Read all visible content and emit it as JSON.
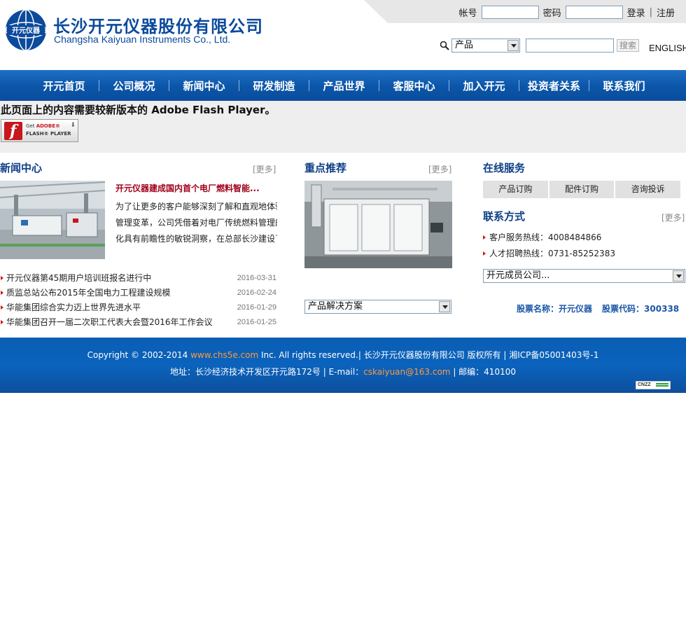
{
  "header": {
    "company_cn": "长沙开元仪器股份有限公司",
    "company_en": "Changsha Kaiyuan Instruments Co., Ltd.",
    "logo_mark_text": "开元仪器",
    "login": {
      "account_label": "帐号",
      "password_label": "密码",
      "login_link": "登录",
      "divider": "|",
      "register_link": "注册"
    },
    "search": {
      "category_selected": "产品",
      "button_label": "搜索"
    },
    "lang_link": "ENGLISH"
  },
  "nav": {
    "items": [
      "开元首页",
      "公司概况",
      "新闻中心",
      "研发制造",
      "产品世界",
      "客服中心",
      "加入开元",
      "投资者关系",
      "联系我们"
    ]
  },
  "flash": {
    "message": "此页面上的内容需要较新版本的  Adobe Flash Player。",
    "badge_line1_a": "Get ",
    "badge_line1_b": "ADOBE®",
    "badge_line2": "FLASH® PLAYER"
  },
  "news": {
    "title": "新闻中心",
    "more": "[更多]",
    "feature_title": "开元仪器建成国内首个电厂燃料智能...",
    "feature_lines": [
      "为了让更多的客户能够深刻了解和直观地体验",
      "管理变革，公司凭借着对电厂传统燃料管理的",
      "化具有前瞻性的敏锐洞察，在总部长沙建设了"
    ],
    "items": [
      {
        "title": "开元仪器第45期用户培训班报名进行中",
        "date": "2016-03-31"
      },
      {
        "title": "质监总站公布2015年全国电力工程建设规模",
        "date": "2016-02-24"
      },
      {
        "title": "华能集团综合实力迈上世界先进水平",
        "date": "2016-01-29"
      },
      {
        "title": "华能集团召开一届二次职工代表大会暨2016年工作会议",
        "date": "2016-01-25"
      }
    ]
  },
  "recommend": {
    "title": "重点推荐",
    "more": "[更多]",
    "select_value": "产品解决方案"
  },
  "service": {
    "title": "在线服务",
    "buttons": [
      "产品订购",
      "配件订购",
      "咨询投诉"
    ]
  },
  "contact": {
    "title": "联系方式",
    "more": "[更多]",
    "items": [
      {
        "label": "客户服务热线：",
        "value": "4008484866"
      },
      {
        "label": "人才招聘热线：",
        "value": "0731-85252383"
      }
    ],
    "member_select_value": "开元成员公司..."
  },
  "stock": {
    "name_label": "股票名称：",
    "name_value": "开元仪器",
    "code_label": "股票代码：",
    "code_value": "300338"
  },
  "footer": {
    "copyright_prefix": "Copyright © 2002-2014 ",
    "site_link": "www.chs5e.com",
    "copyright_suffix": " Inc. All rights reserved.| 长沙开元仪器股份有限公司  版权所有  | 湘ICP备05001403号-1",
    "address": "地址：长沙经济技术开发区开元路172号  | E-mail：",
    "email": "cskaiyuan@163.com",
    "postcode": " | 邮编：410100",
    "cnzz_badge": "CNZZ"
  },
  "colors": {
    "brand_blue": "#0b4a9c",
    "nav_blue": "#0b55a8",
    "accent_red": "#c8161d",
    "footer_link": "#ff9a3c"
  }
}
